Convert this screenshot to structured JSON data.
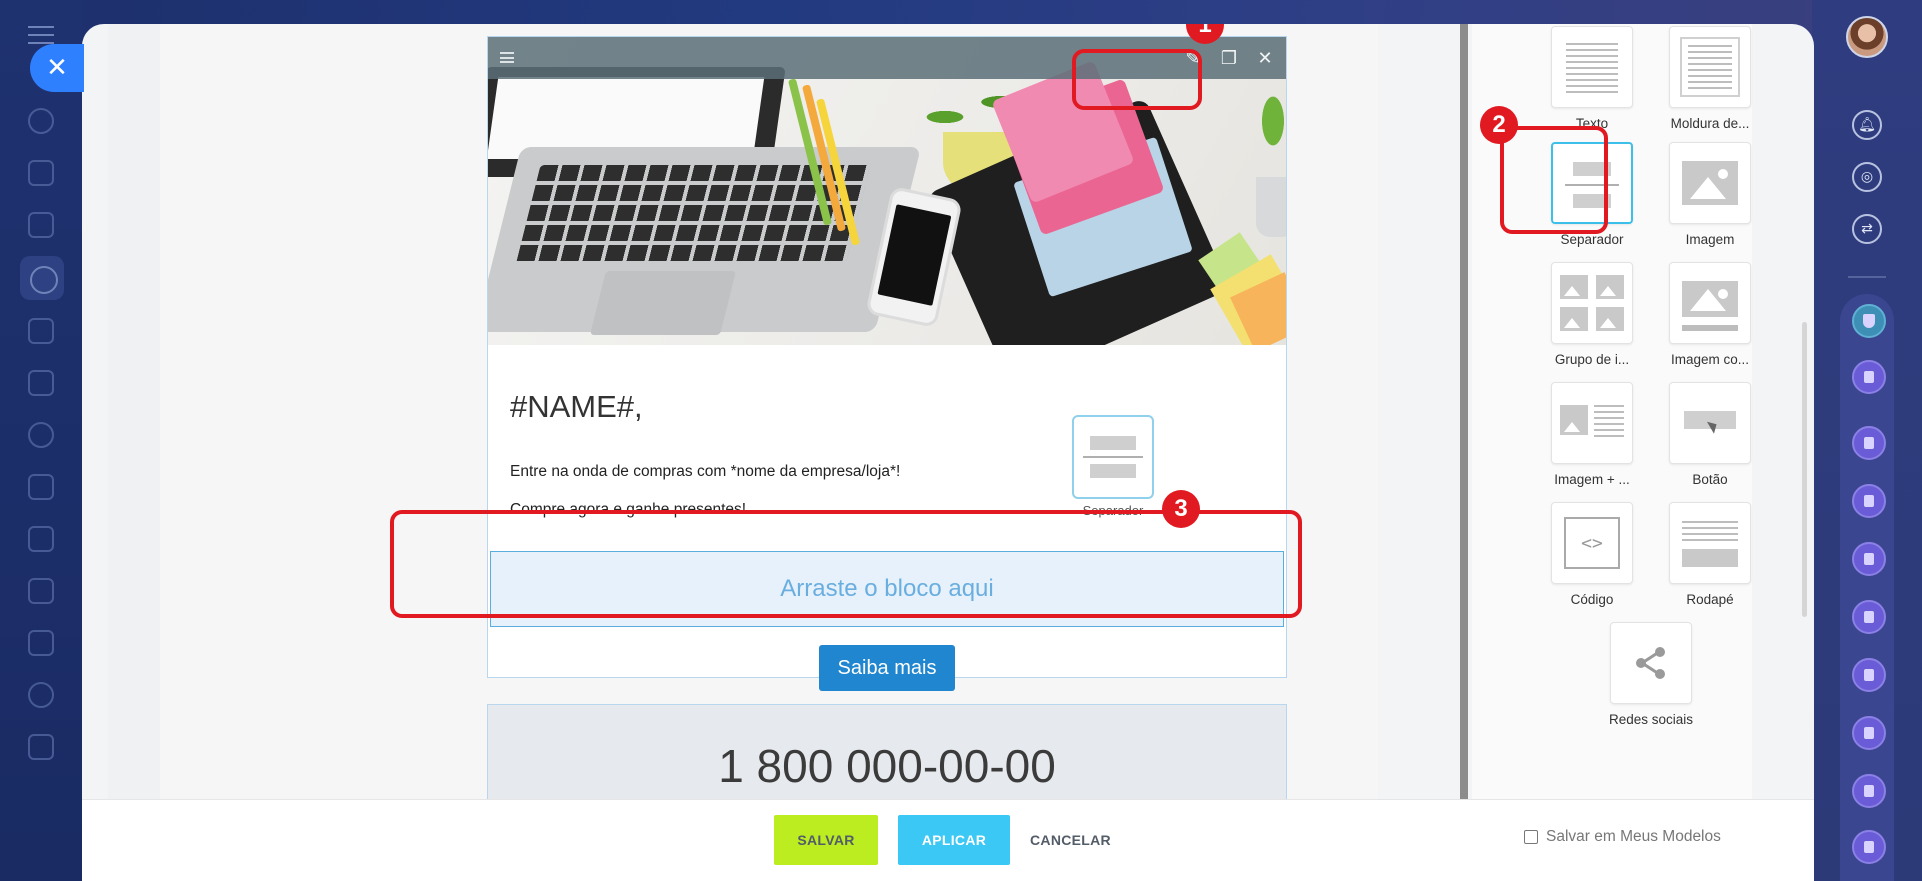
{
  "toolbar": {
    "edit_icon": "pencil-icon",
    "copy_icon": "copy-icon",
    "delete_icon": "close-icon"
  },
  "email": {
    "headline": "#NAME#,",
    "line1": "Entre na onda de compras com *nome da empresa/loja*!",
    "line2": "Compre agora e ganhe presentes!",
    "dragging_block_label": "Separador",
    "dropzone_text": "Arraste o bloco aqui",
    "cta_label": "Saiba mais",
    "phone": "1 800 000-00-00"
  },
  "palette": {
    "items": [
      {
        "label": "Texto",
        "icon": "text-block-icon"
      },
      {
        "label": "Moldura de...",
        "icon": "frame-block-icon"
      },
      {
        "label": "Separador",
        "icon": "separator-block-icon"
      },
      {
        "label": "Imagem",
        "icon": "image-block-icon"
      },
      {
        "label": "Grupo de i...",
        "icon": "image-group-block-icon"
      },
      {
        "label": "Imagem co...",
        "icon": "image-caption-block-icon"
      },
      {
        "label": "Imagem + ...",
        "icon": "image-text-block-icon"
      },
      {
        "label": "Botão",
        "icon": "button-block-icon"
      },
      {
        "label": "Código",
        "icon": "code-block-icon"
      },
      {
        "label": "Rodapé",
        "icon": "footer-block-icon"
      },
      {
        "label": "Redes sociais",
        "icon": "share-icon"
      }
    ]
  },
  "callouts": [
    "1",
    "2",
    "3"
  ],
  "actions": {
    "save": "SALVAR",
    "apply": "APLICAR",
    "cancel": "CANCELAR",
    "save_template": "Salvar em Meus Modelos"
  },
  "colors": {
    "accent_blue": "#2f80ff",
    "save_green": "#bbed21",
    "apply_blue": "#3bc8f5",
    "callout_red": "#e11a22",
    "cta_blue": "#1f86cf"
  }
}
